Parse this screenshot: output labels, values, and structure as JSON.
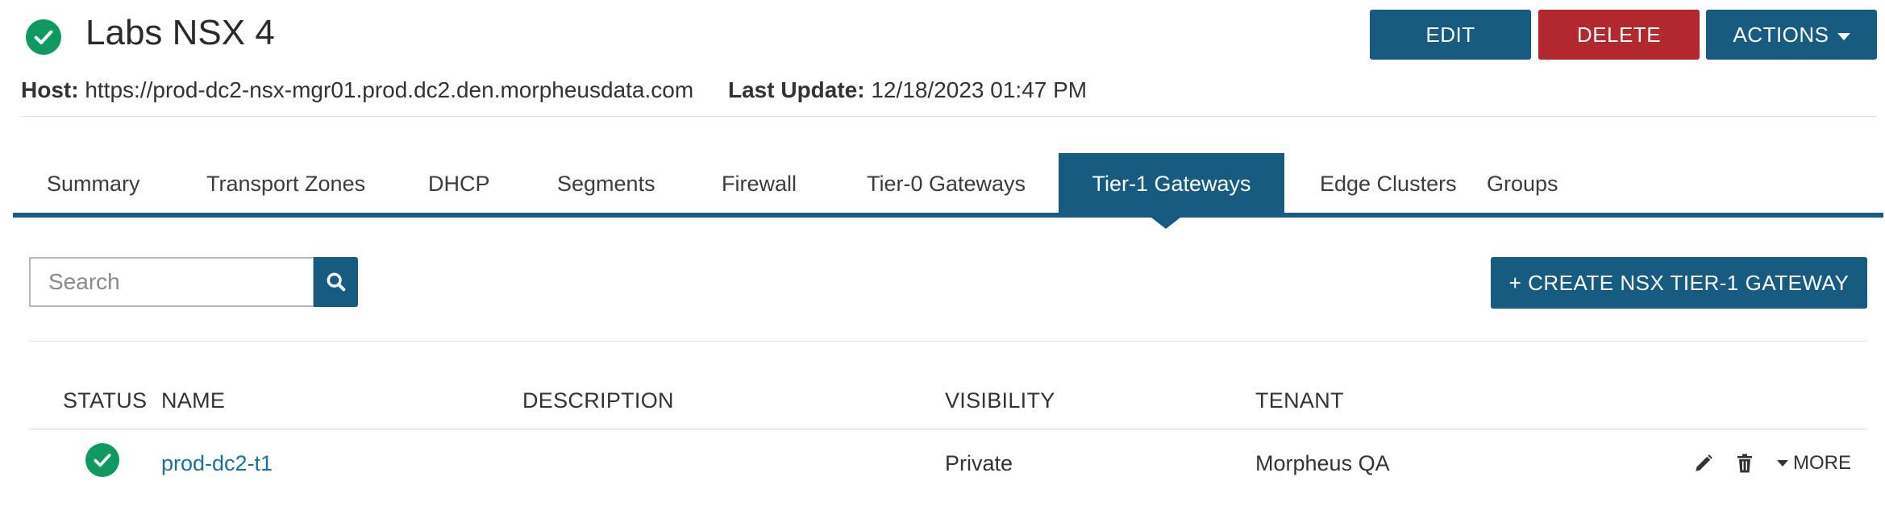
{
  "header": {
    "title": "Labs NSX 4",
    "buttons": {
      "edit": "EDIT",
      "delete": "DELETE",
      "actions": "ACTIONS"
    }
  },
  "meta": {
    "host_label": "Host:",
    "host_value": "https://prod-dc2-nsx-mgr01.prod.dc2.den.morpheusdata.com",
    "last_update_label": "Last Update:",
    "last_update_value": "12/18/2023 01:47 PM"
  },
  "tabs": [
    {
      "label": "Summary"
    },
    {
      "label": "Transport Zones"
    },
    {
      "label": "DHCP"
    },
    {
      "label": "Segments"
    },
    {
      "label": "Firewall"
    },
    {
      "label": "Tier-0 Gateways"
    },
    {
      "label": "Tier-1 Gateways",
      "active": true
    },
    {
      "label": "Edge Clusters"
    },
    {
      "label": "Groups"
    }
  ],
  "search": {
    "placeholder": "Search"
  },
  "create_button": "+ CREATE NSX TIER-1 GATEWAY",
  "table": {
    "columns": [
      "STATUS",
      "NAME",
      "DESCRIPTION",
      "VISIBILITY",
      "TENANT"
    ],
    "rows": [
      {
        "name": "prod-dc2-t1",
        "description": "",
        "visibility": "Private",
        "tenant": "Morpheus QA",
        "more": "MORE"
      }
    ]
  },
  "colors": {
    "accent": "#185b80",
    "danger": "#b3272f",
    "success": "#0f9960",
    "link": "#1c6f98"
  },
  "icons": [
    "check-circle-icon",
    "search-icon",
    "pencil-icon",
    "trash-icon",
    "caret-down-icon"
  ]
}
